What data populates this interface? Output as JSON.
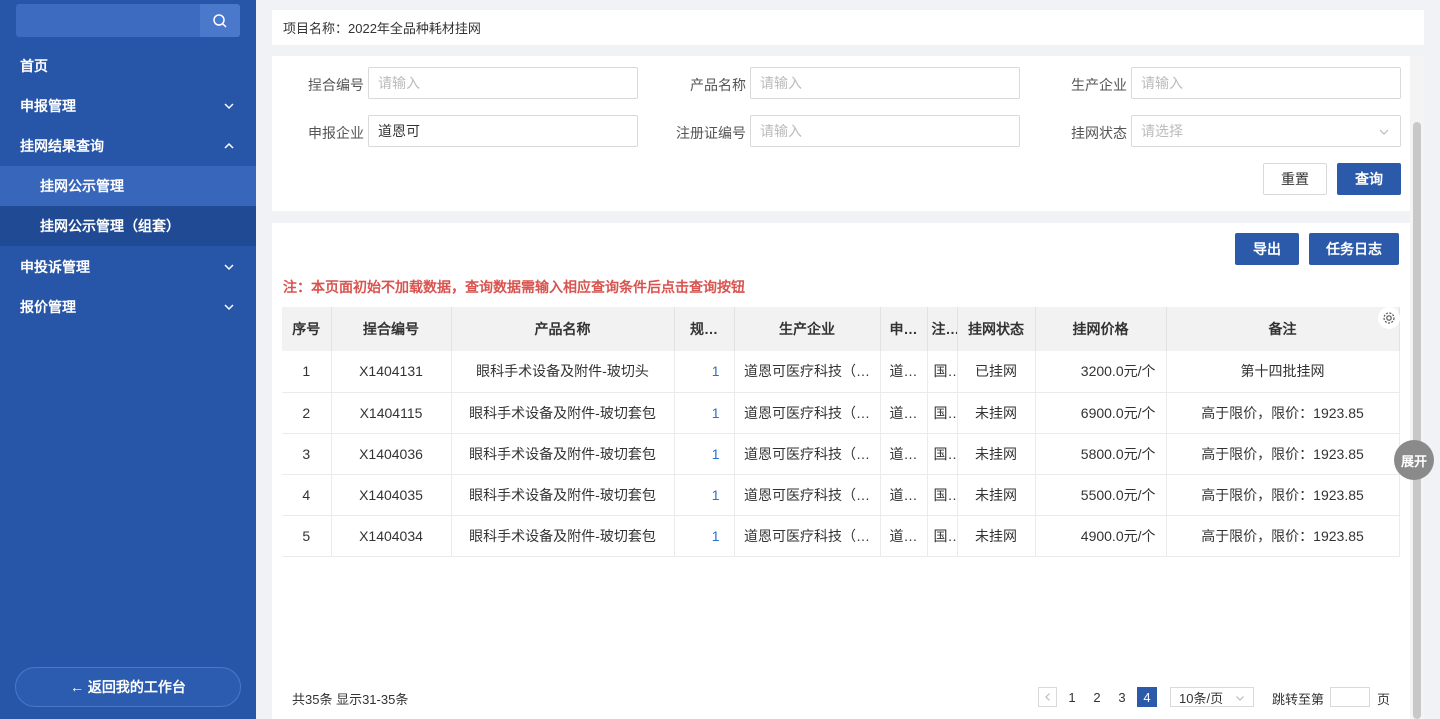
{
  "sidebar": {
    "menu": [
      {
        "label": "首页"
      },
      {
        "label": "申报管理"
      },
      {
        "label": "挂网结果查询"
      },
      {
        "label": "挂网公示管理"
      },
      {
        "label": "挂网公示管理（组套）"
      },
      {
        "label": "申投诉管理"
      },
      {
        "label": "报价管理"
      }
    ],
    "back_label": "← 返回我的工作台",
    "search_icon": "search-icon"
  },
  "project": {
    "text": "项目名称：2022年全品种耗材挂网"
  },
  "filters": {
    "combo_code": {
      "label": "挰合编号",
      "placeholder": "请输入",
      "value": ""
    },
    "product_name": {
      "label": "产品名称",
      "placeholder": "请输入",
      "value": ""
    },
    "manufacturer": {
      "label": "生产企业",
      "placeholder": "请输入",
      "value": ""
    },
    "applicant": {
      "label": "申报企业",
      "placeholder": "请输入",
      "value": "道恩可"
    },
    "reg_no": {
      "label": "注册证编号",
      "placeholder": "请输入",
      "value": ""
    },
    "status": {
      "label": "挂网状态",
      "placeholder": "请选择",
      "value": ""
    }
  },
  "buttons": {
    "reset": "重置",
    "query": "查询",
    "export": "导出",
    "task_log": "任务日志",
    "expand": "展开"
  },
  "notice": "注：本页面初始不加载数据，查询数据需输入相应查询条件后点击查询按钮",
  "table": {
    "headers": [
      "序号",
      "挰合编号",
      "产品名称",
      "规…",
      "生产企业",
      "申…",
      "注…",
      "挂网状态",
      "挂网价格",
      "备注"
    ],
    "rows": [
      [
        "1",
        "X1404131",
        "眼科手术设备及附件-玻切头",
        "1",
        "道恩可医疗科技（…",
        "道…",
        "国…",
        "已挂网",
        "3200.0元/个",
        "第十四批挂网"
      ],
      [
        "2",
        "X1404115",
        "眼科手术设备及附件-玻切套包",
        "1",
        "道恩可医疗科技（…",
        "道…",
        "国…",
        "未挂网",
        "6900.0元/个",
        "高于限价，限价：1923.85"
      ],
      [
        "3",
        "X1404036",
        "眼科手术设备及附件-玻切套包",
        "1",
        "道恩可医疗科技（…",
        "道…",
        "国…",
        "未挂网",
        "5800.0元/个",
        "高于限价，限价：1923.85"
      ],
      [
        "4",
        "X1404035",
        "眼科手术设备及附件-玻切套包",
        "1",
        "道恩可医疗科技（…",
        "道…",
        "国…",
        "未挂网",
        "5500.0元/个",
        "高于限价，限价：1923.85"
      ],
      [
        "5",
        "X1404034",
        "眼科手术设备及附件-玻切套包",
        "1",
        "道恩可医疗科技（…",
        "道…",
        "国…",
        "未挂网",
        "4900.0元/个",
        "高于限价，限价：1923.85"
      ]
    ]
  },
  "pagination": {
    "total": "共35条 显示31-35条",
    "pages": [
      "1",
      "2",
      "3",
      "4"
    ],
    "current": "4",
    "page_size": "10条/页",
    "jump_label": "跳转至第",
    "jump_suffix": "页"
  },
  "colors": {
    "sidebar": "#2755a8",
    "primary": "#2b5aab",
    "notice": "#d9534f",
    "link": "#2b6fd6"
  }
}
